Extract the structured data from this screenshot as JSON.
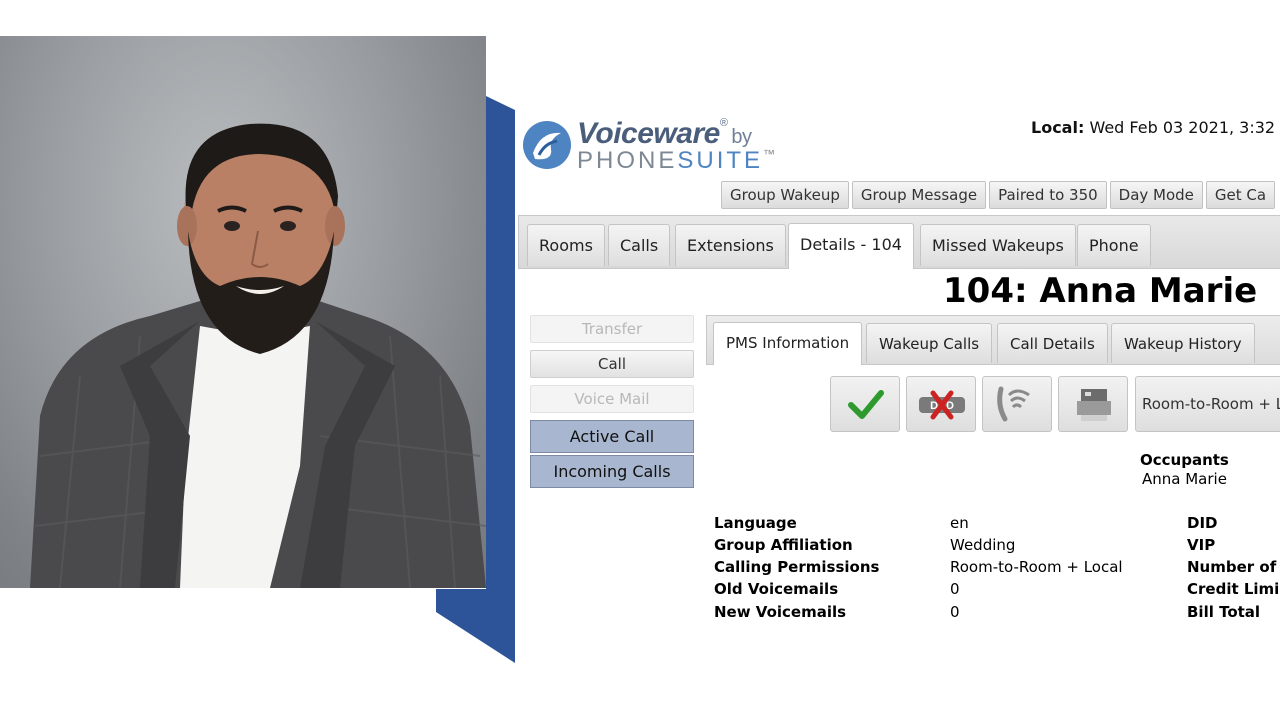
{
  "logo": {
    "brand_main": "Voiceware",
    "brand_by": "by",
    "brand_sub_1": "PHONE",
    "brand_sub_2": "SUITE"
  },
  "header": {
    "local_label": "Local:",
    "local_datetime": "Wed Feb 03 2021, 3:32"
  },
  "toolbar": {
    "buttons": [
      "Group Wakeup",
      "Group Message",
      "Paired to 350",
      "Day Mode",
      "Get Ca"
    ]
  },
  "tabs": [
    "Rooms",
    "Calls",
    "Extensions",
    "Details - 104",
    "Missed Wakeups",
    "Phone"
  ],
  "room_title": "104: Anna Marie",
  "side_buttons": {
    "transfer": "Transfer",
    "call": "Call",
    "voice_mail": "Voice Mail",
    "active_call": "Active Call",
    "incoming_calls": "Incoming Calls"
  },
  "subtabs": [
    "PMS Information",
    "Wakeup Calls",
    "Call Details",
    "Wakeup History"
  ],
  "icon_buttons": [
    "check-icon",
    "dnd-icon",
    "phone-signal-icon",
    "fax-machine-icon"
  ],
  "permission_button": "Room-to-Room + Lo",
  "occupants": {
    "label": "Occupants",
    "value": "Anna Marie"
  },
  "fields": [
    {
      "label": "Language",
      "value": "en"
    },
    {
      "label": "Group Affiliation",
      "value": "Wedding"
    },
    {
      "label": "Calling Permissions",
      "value": "Room-to-Room + Local"
    },
    {
      "label": "Old Voicemails",
      "value": "0"
    },
    {
      "label": "New Voicemails",
      "value": "0"
    }
  ],
  "fields_right": [
    "DID",
    "VIP",
    "Number of",
    "Credit Limi",
    "Bill Total"
  ],
  "colors": {
    "accent_blue": "#2d5498",
    "active_side_button": "#a8b6cf",
    "check_green": "#2e9a2e",
    "dnd_red": "#cc2222"
  }
}
